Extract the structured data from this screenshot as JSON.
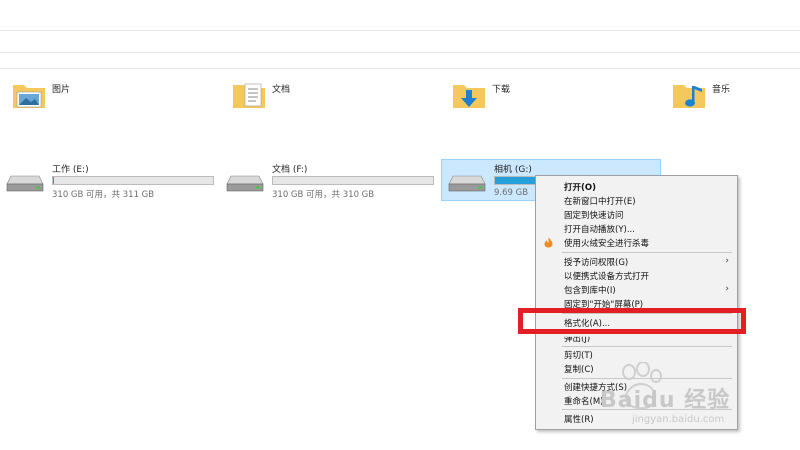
{
  "folders": [
    {
      "label": "图片",
      "icon": "pictures-folder-icon"
    },
    {
      "label": "文档",
      "icon": "documents-folder-icon"
    },
    {
      "label": "下载",
      "icon": "downloads-folder-icon"
    },
    {
      "label": "音乐",
      "icon": "music-folder-icon"
    }
  ],
  "drives": [
    {
      "name": "工作 (E:)",
      "capacity": "310 GB 可用，共 311 GB",
      "used_fraction": 0.003,
      "selected": false
    },
    {
      "name": "文档 (F:)",
      "capacity": "310 GB 可用，共 310 GB",
      "used_fraction": 0.0,
      "selected": false
    },
    {
      "name": "相机 (G:)",
      "capacity": "9.69 GB",
      "used_fraction": 0.25,
      "selected": true
    }
  ],
  "menu": {
    "open": "打开(O)",
    "open_new_window": "在新窗口中打开(E)",
    "pin_quick_access": "固定到快速访问",
    "open_autoplay": "打开自动播放(Y)...",
    "scan_huorong": "使用火绒安全进行杀毒",
    "grant_access": "授予访问权限(G)",
    "open_as_portable": "以便携式设备方式打开",
    "include_in_library": "包含到库中(I)",
    "pin_to_start": "固定到\"开始\"屏幕(P)",
    "format": "格式化(A)...",
    "eject": "弹出(J)",
    "cut": "剪切(T)",
    "copy": "复制(C)",
    "create_shortcut": "创建快捷方式(S)",
    "rename": "重命名(M)",
    "properties": "属性(R)"
  },
  "watermark": {
    "brand": "Baidu 经验",
    "url": "jingyan.baidu.com"
  },
  "colors": {
    "highlight_box": "#e31e24",
    "selection": "#cce8ff",
    "drive_bar": "#26a0da",
    "folder": "#f5c85d"
  }
}
